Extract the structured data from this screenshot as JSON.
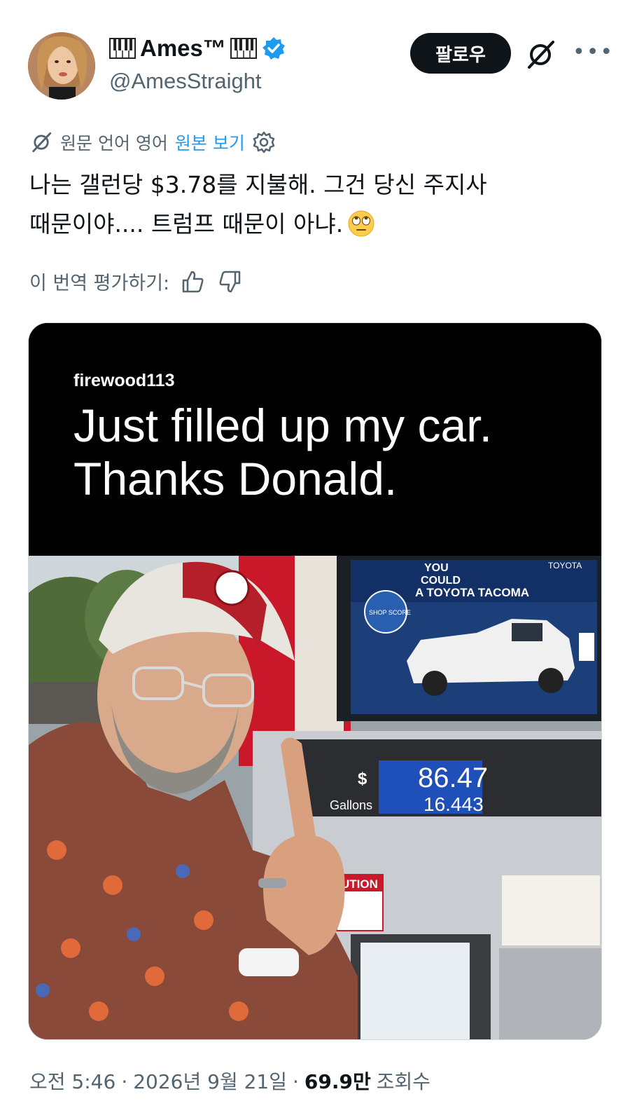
{
  "header": {
    "display_name": "Ames™",
    "handle": "@AmesStraight",
    "follow_label": "팔로우"
  },
  "translation": {
    "source_label": "원문 언어 영어",
    "show_original": "원본 보기"
  },
  "tweet": {
    "text": "나는 갤런당 $3.78를 지불해. 그건 당신 주지사 때문이야.... 트럼프 때문이 아냐."
  },
  "rate": {
    "label": "이 번역 평가하기:"
  },
  "media": {
    "overlay_user": "firewood113",
    "overlay_text": "Just filled up my car.\nThanks Donald.",
    "pump": {
      "dollar_symbol": "$",
      "amount": "86.47",
      "gallons_label": "Gallons",
      "gallons": "16.443"
    },
    "ad": {
      "line1": "YOU",
      "line2": "COULD",
      "line3": "A TOYOTA TACOMA",
      "brand": "TOYOTA",
      "badge": "SHOP SCORE"
    },
    "caution": "UTION"
  },
  "footer": {
    "time": "오전 5:46",
    "date": "2026년 9월 21일",
    "views": "69.9만",
    "views_label": "조회수"
  },
  "colors": {
    "link": "#1d9bf0",
    "muted": "#536471",
    "verified": "#1d9bf0",
    "button": "#0f1419"
  }
}
